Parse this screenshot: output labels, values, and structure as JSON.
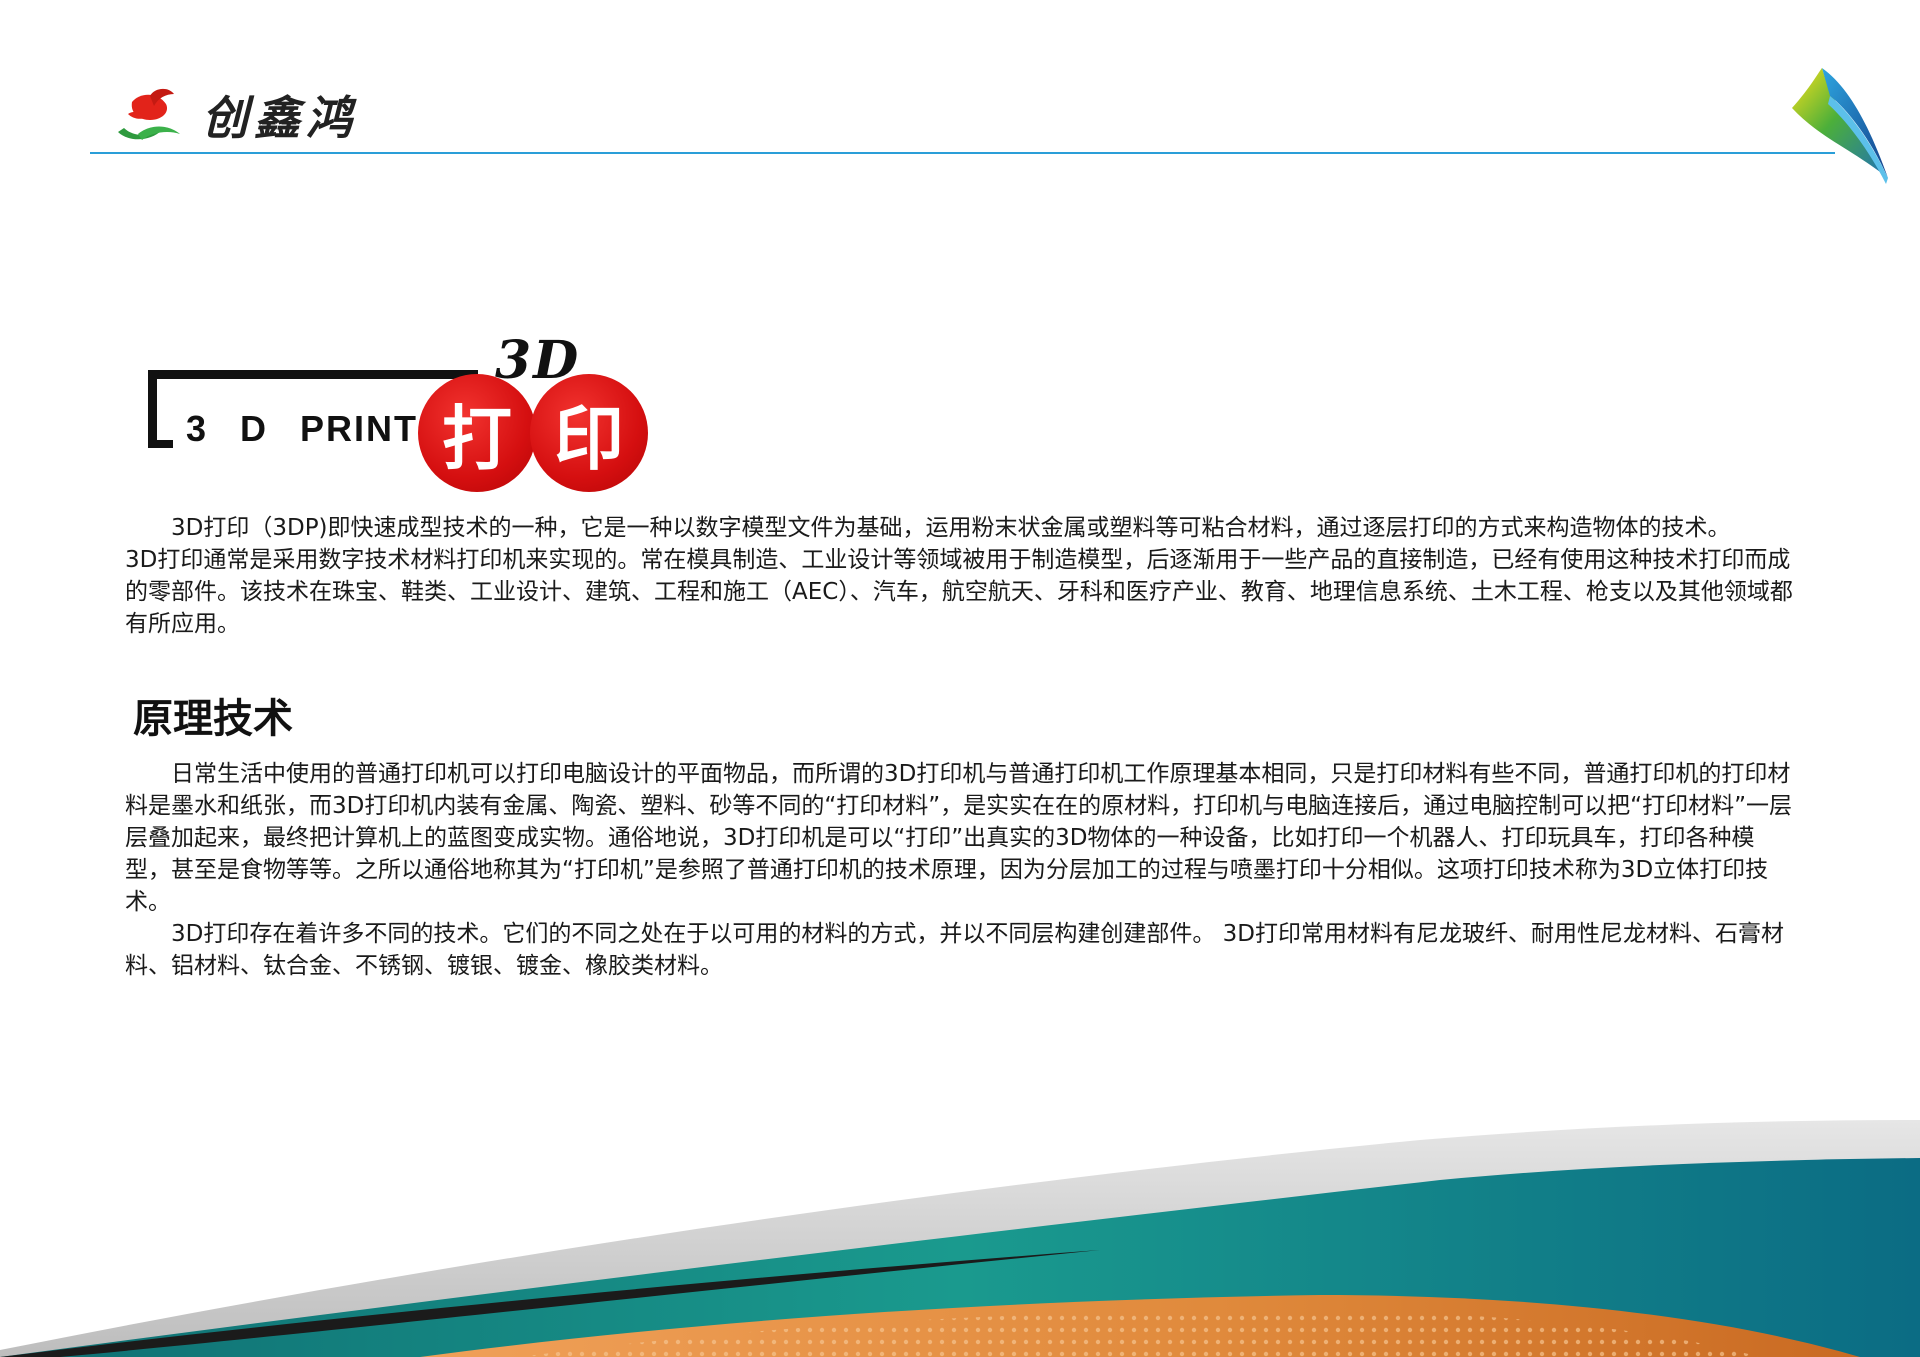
{
  "header": {
    "brand_name": "创鑫鸿"
  },
  "title_graphic": {
    "small_3d": "3D",
    "print_label": "3 D PRINT",
    "circle_1": "打",
    "circle_2": "印"
  },
  "intro": {
    "p1": "3D打印（3DP)即快速成型技术的一种，它是一种以数字模型文件为基础，运用粉末状金属或塑料等可粘合材料，通过逐层打印的方式来构造物体的技术。",
    "p2": "3D打印通常是采用数字技术材料打印机来实现的。常在模具制造、工业设计等领域被用于制造模型，后逐渐用于一些产品的直接制造，已经有使用这种技术打印而成的零部件。该技术在珠宝、鞋类、工业设计、建筑、工程和施工（AEC）、汽车，航空航天、牙科和医疗产业、教育、地理信息系统、土木工程、枪支以及其他领域都有所应用。"
  },
  "section": {
    "heading": "原理技术",
    "p1": "日常生活中使用的普通打印机可以打印电脑设计的平面物品，而所谓的3D打印机与普通打印机工作原理基本相同，只是打印材料有些不同，普通打印机的打印材料是墨水和纸张，而3D打印机内装有金属、陶瓷、塑料、砂等不同的“打印材料”，是实实在在的原材料，打印机与电脑连接后，通过电脑控制可以把“打印材料”一层层叠加起来，最终把计算机上的蓝图变成实物。通俗地说，3D打印机是可以“打印”出真实的3D物体的一种设备，比如打印一个机器人、打印玩具车，打印各种模型，甚至是食物等等。之所以通俗地称其为“打印机”是参照了普通打印机的技术原理，因为分层加工的过程与喷墨打印十分相似。这项打印技术称为3D立体打印技术。",
    "p2": "3D打印存在着许多不同的技术。它们的不同之处在于以可用的材料的方式，并以不同层构建创建部件。 3D打印常用材料有尼龙玻纤、耐用性尼龙材料、石膏材料、铝材料、钛合金、不锈钢、镀银、镀金、橡胶类材料。"
  },
  "colors": {
    "rule_blue": "#2a9ed8",
    "seal_red": "#d50f10",
    "teal": "#1a8f8f",
    "orange": "#e08a3c"
  }
}
